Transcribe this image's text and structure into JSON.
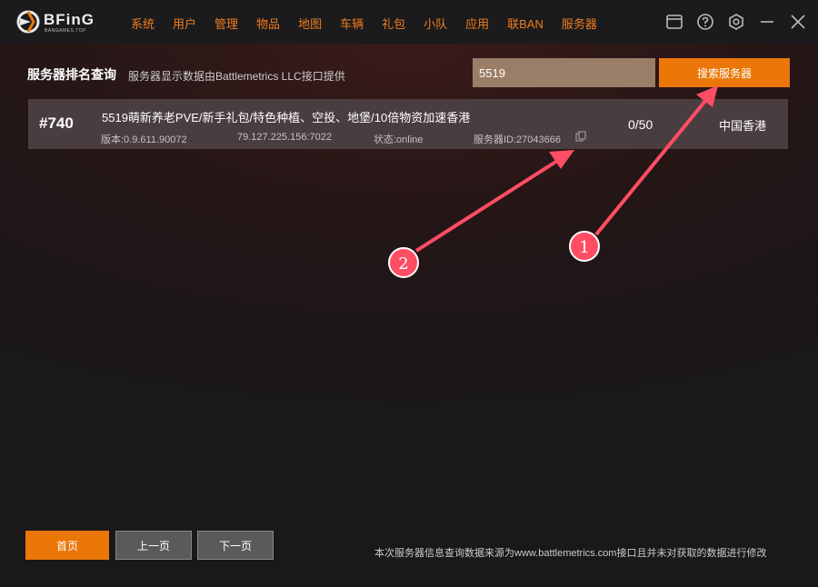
{
  "app": {
    "logo_text": "BFinG",
    "logo_sub": "BANGAMES.TOP"
  },
  "nav": [
    "系统",
    "用户",
    "管理",
    "物品",
    "地图",
    "车辆",
    "礼包",
    "小队",
    "应用",
    "联BAN",
    "服务器"
  ],
  "page": {
    "title": "服务器排名查询",
    "subtitle": "服务器显示数据由Battlemetrics  LLC接口提供"
  },
  "search": {
    "value": "5519",
    "button_label": "搜索服务器"
  },
  "servers": [
    {
      "rank": "#740",
      "name": "5519萌新养老PVE/新手礼包/特色种植、空投、地堡/10倍物资加速香港",
      "version": "版本:0.9.611.90072",
      "address": "79.127.225.156:7022",
      "status": "状态:online",
      "server_id": "服务器ID:27043666",
      "players": "0/50",
      "region": "中国香港"
    }
  ],
  "pager": {
    "first": "首页",
    "prev": "上一页",
    "next": "下一页"
  },
  "footer": {
    "note": "本次服务器信息查询数据来源为www.battlemetrics.com接口且并未对获取的数据进行修改"
  },
  "annotations": {
    "markers": [
      "1",
      "2"
    ],
    "color": "#ff4d64"
  },
  "colors": {
    "accent": "#ea7708",
    "nav_text": "#f07d1e"
  }
}
